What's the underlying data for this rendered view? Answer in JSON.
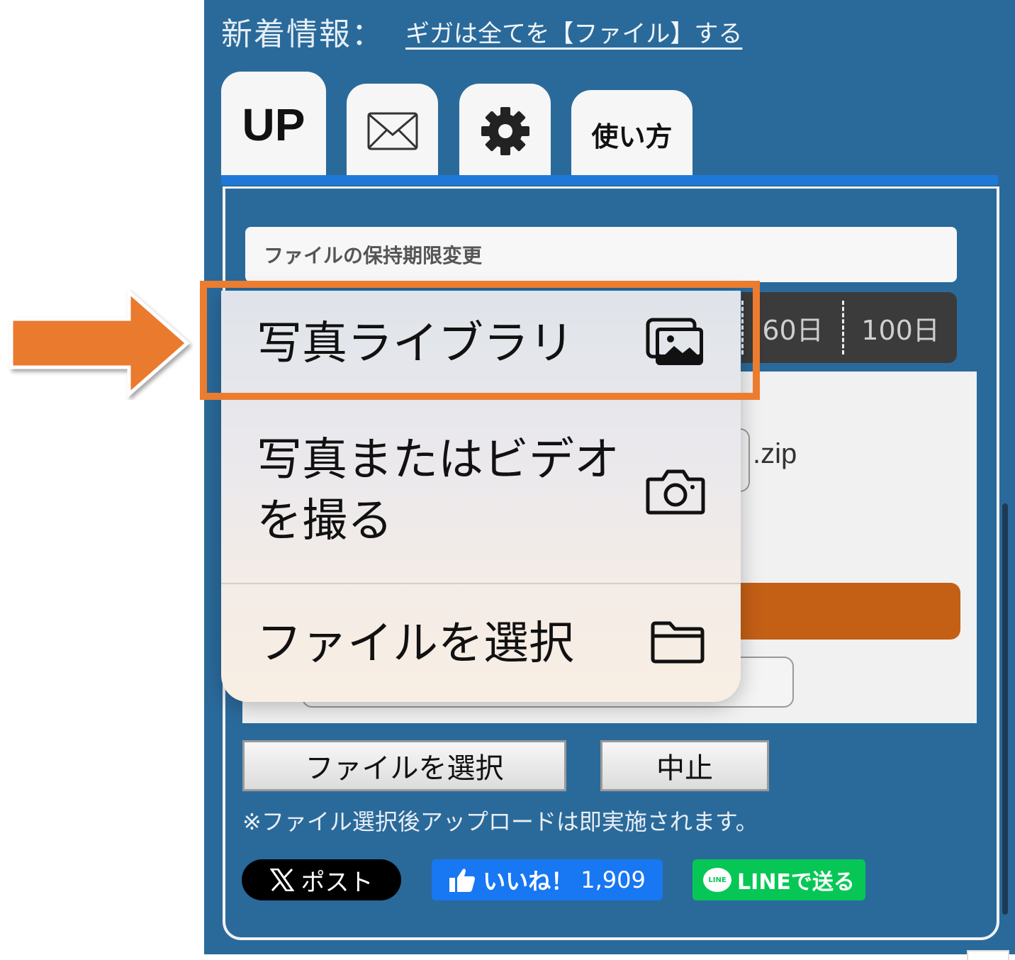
{
  "news": {
    "label": "新着情報：",
    "link": "ギガは全てを【ファイル】する"
  },
  "tabs": {
    "up": "UP",
    "mail_icon": "envelope-icon",
    "settings_icon": "gear-icon",
    "help": "使い方"
  },
  "retention": {
    "title": "ファイルの保持期限変更",
    "days": [
      "60日",
      "100日"
    ]
  },
  "archive": {
    "extension": ".zip"
  },
  "picker_menu": {
    "items": [
      {
        "label": "写真ライブラリ",
        "icon": "photo-library-icon"
      },
      {
        "label_line1": "写真またはビデオ",
        "label_line2": "を撮る",
        "icon": "camera-icon"
      },
      {
        "label": "ファイルを選択",
        "icon": "folder-icon"
      }
    ]
  },
  "buttons": {
    "select_file": "ファイルを選択",
    "cancel": "中止"
  },
  "note": "※ファイル選択後アップロードは即実施されます。",
  "share": {
    "x_post": "ポスト",
    "like": "いいね！",
    "like_count": "1,909",
    "line": "LINEで送る",
    "line_logo": "LINE"
  },
  "colors": {
    "panel": "#2a6a9b",
    "tab_accent": "#1e78d8",
    "highlight": "#ec7c2f",
    "progress_bar": "#c45f16"
  }
}
